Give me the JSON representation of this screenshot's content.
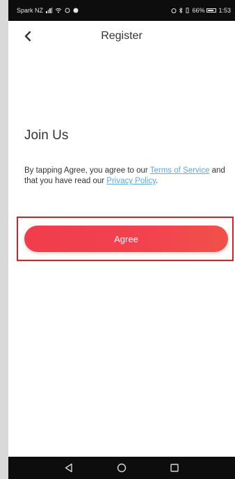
{
  "status_bar": {
    "carrier": "Spark NZ",
    "battery_text": "66%",
    "time": "1:53"
  },
  "header": {
    "title": "Register",
    "back_icon": "chevron-left-icon"
  },
  "content": {
    "title": "Join Us",
    "terms_prefix": "By tapping Agree, you agree to our ",
    "terms_link": "Terms of Service",
    "terms_middle": " and that you have read our ",
    "privacy_link": "Privacy Policy",
    "terms_suffix": "."
  },
  "agree_button": {
    "label": "Agree"
  },
  "nav_bar": {
    "icons": [
      "back-triangle-icon",
      "home-circle-icon",
      "recents-square-icon"
    ]
  },
  "colors": {
    "accent": "#ef3d4c",
    "link": "#5aa8e8",
    "highlight": "#d81f26"
  }
}
